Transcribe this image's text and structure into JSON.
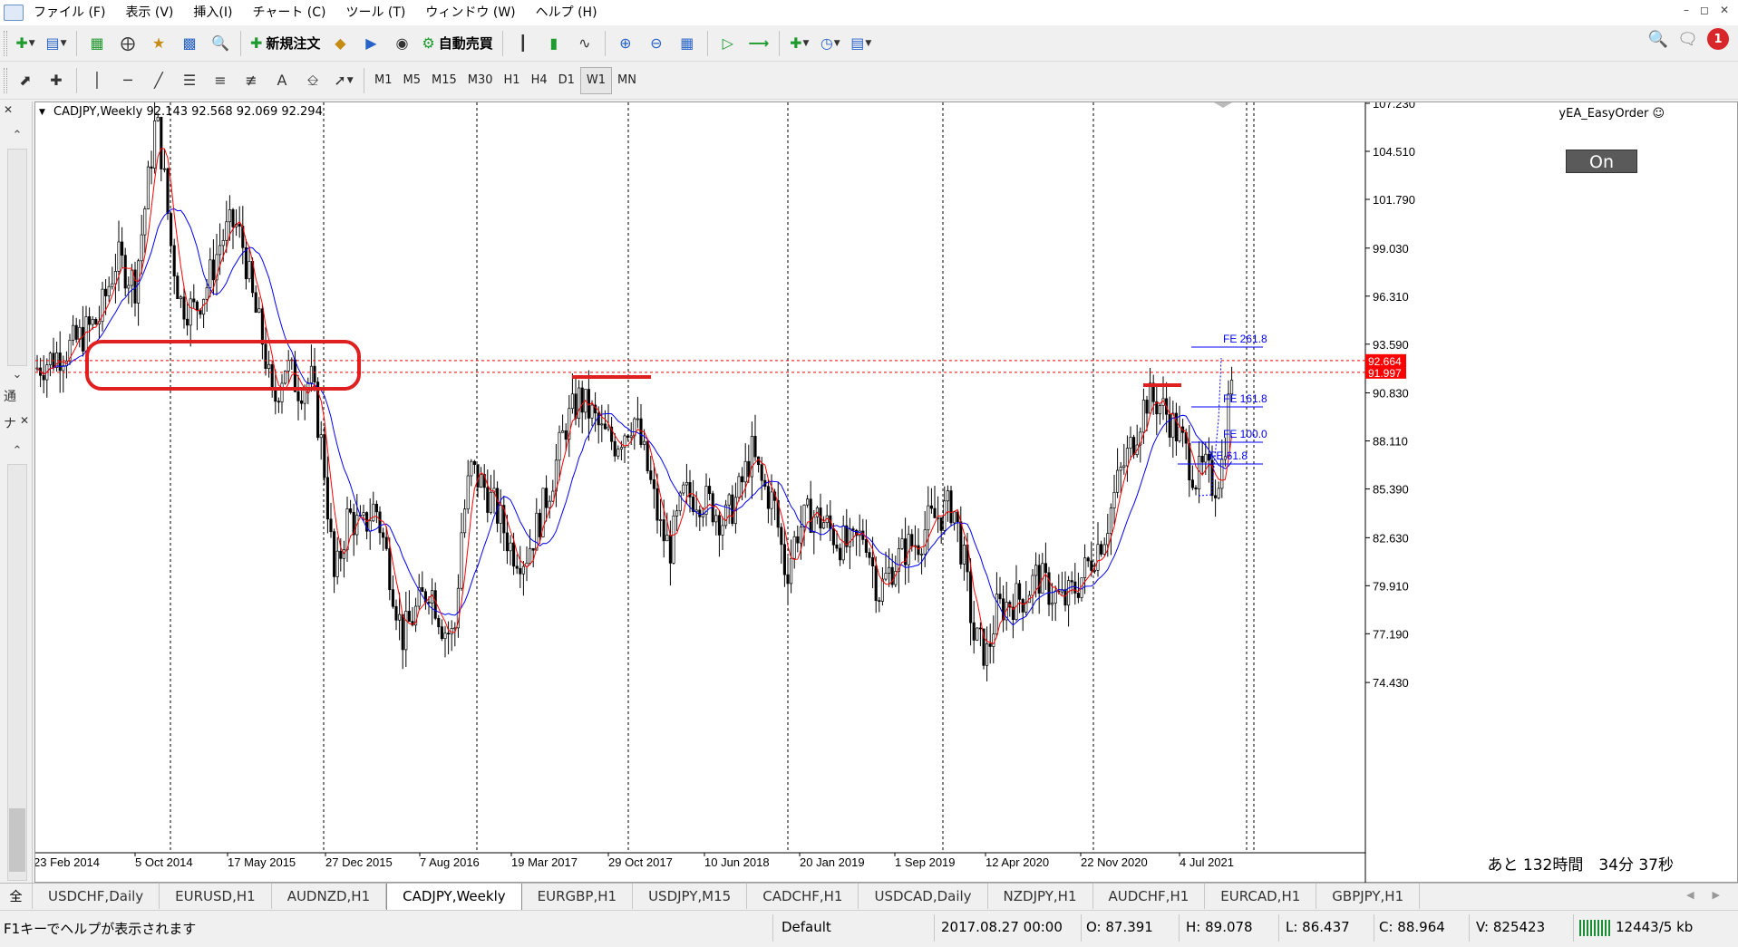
{
  "menubar": {
    "items": [
      "ファイル (F)",
      "表示 (V)",
      "挿入(I)",
      "チャート (C)",
      "ツール (T)",
      "ウィンドウ (W)",
      "ヘルプ (H)"
    ]
  },
  "toolbar": {
    "new_order_label": "新規注文",
    "auto_trade_label": "自動売買",
    "timeframes": [
      "M1",
      "M5",
      "M15",
      "M30",
      "H1",
      "H4",
      "D1",
      "W1",
      "MN"
    ],
    "active_timeframe": "W1",
    "notification_count": "1"
  },
  "left_panel": {
    "tab1": "通",
    "tab2": "全",
    "tab3": "ナ"
  },
  "chart": {
    "title": "CADJPY,Weekly  92.143 92.568 92.069 92.294",
    "ea_label": "yEA_EasyOrder ☺",
    "on_button": "On",
    "countdown": "あと 132時間　34分 37秒",
    "price_labels": [
      "107.230",
      "104.510",
      "101.790",
      "99.030",
      "96.310",
      "93.590",
      "90.830",
      "88.110",
      "85.390",
      "82.630",
      "79.910",
      "77.190",
      "74.430"
    ],
    "current_price_tags": [
      "92.664",
      "91.997"
    ],
    "date_labels": [
      "23 Feb 2014",
      "5 Oct 2014",
      "17 May 2015",
      "27 Dec 2015",
      "7 Aug 2016",
      "19 Mar 2017",
      "29 Oct 2017",
      "10 Jun 2018",
      "20 Jan 2019",
      "1 Sep 2019",
      "12 Apr 2020",
      "22 Nov 2020",
      "4 Jul 2021"
    ],
    "fe_labels": [
      "FE 261.8",
      "FE 161.8",
      "FE 100.0",
      "FE 61.8"
    ],
    "colors": {
      "ma_fast": "#ff0000",
      "ma_slow": "#0000ff",
      "annotation": "#e02020",
      "price_tag": "#ff0000",
      "fibo": "#0000ff"
    }
  },
  "tabs": {
    "items": [
      "USDCHF,Daily",
      "EURUSD,H1",
      "AUDNZD,H1",
      "CADJPY,Weekly",
      "EURGBP,H1",
      "USDJPY,M15",
      "CADCHF,H1",
      "USDCAD,Daily",
      "NZDJPY,H1",
      "AUDCHF,H1",
      "EURCAD,H1",
      "GBPJPY,H1"
    ],
    "active": "CADJPY,Weekly"
  },
  "status": {
    "help": "F1キーでヘルプが表示されます",
    "profile": "Default",
    "datetime": "2017.08.27 00:00",
    "open": "O: 87.391",
    "high": "H: 89.078",
    "low": "L: 86.437",
    "close": "C: 88.964",
    "volume": "V: 825423",
    "traffic": "12443/5 kb"
  }
}
